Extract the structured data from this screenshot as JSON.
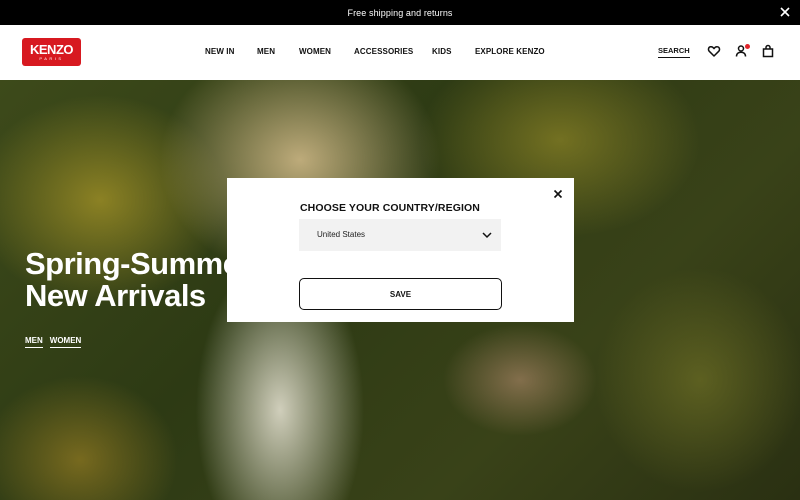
{
  "announcement": {
    "text": "Free shipping and returns",
    "close_icon": "close-icon"
  },
  "header": {
    "logo": {
      "word": "KENZO",
      "sub": "PARIS"
    },
    "nav": [
      "NEW IN",
      "MEN",
      "WOMEN",
      "ACCESSORIES",
      "KIDS",
      "EXPLORE KENZO"
    ],
    "search_label": "SEARCH",
    "icons": [
      "heart-icon",
      "account-icon",
      "bag-icon"
    ]
  },
  "hero": {
    "title": "Spring-Summer\nNew Arrivals",
    "links": [
      "MEN",
      "WOMEN"
    ]
  },
  "modal": {
    "heading": "CHOOSE YOUR COUNTRY/REGION",
    "selected_country": "United States",
    "save_label": "SAVE"
  },
  "colors": {
    "brand": "#d71920",
    "notification": "#e0242b",
    "topbar": "#000000"
  }
}
